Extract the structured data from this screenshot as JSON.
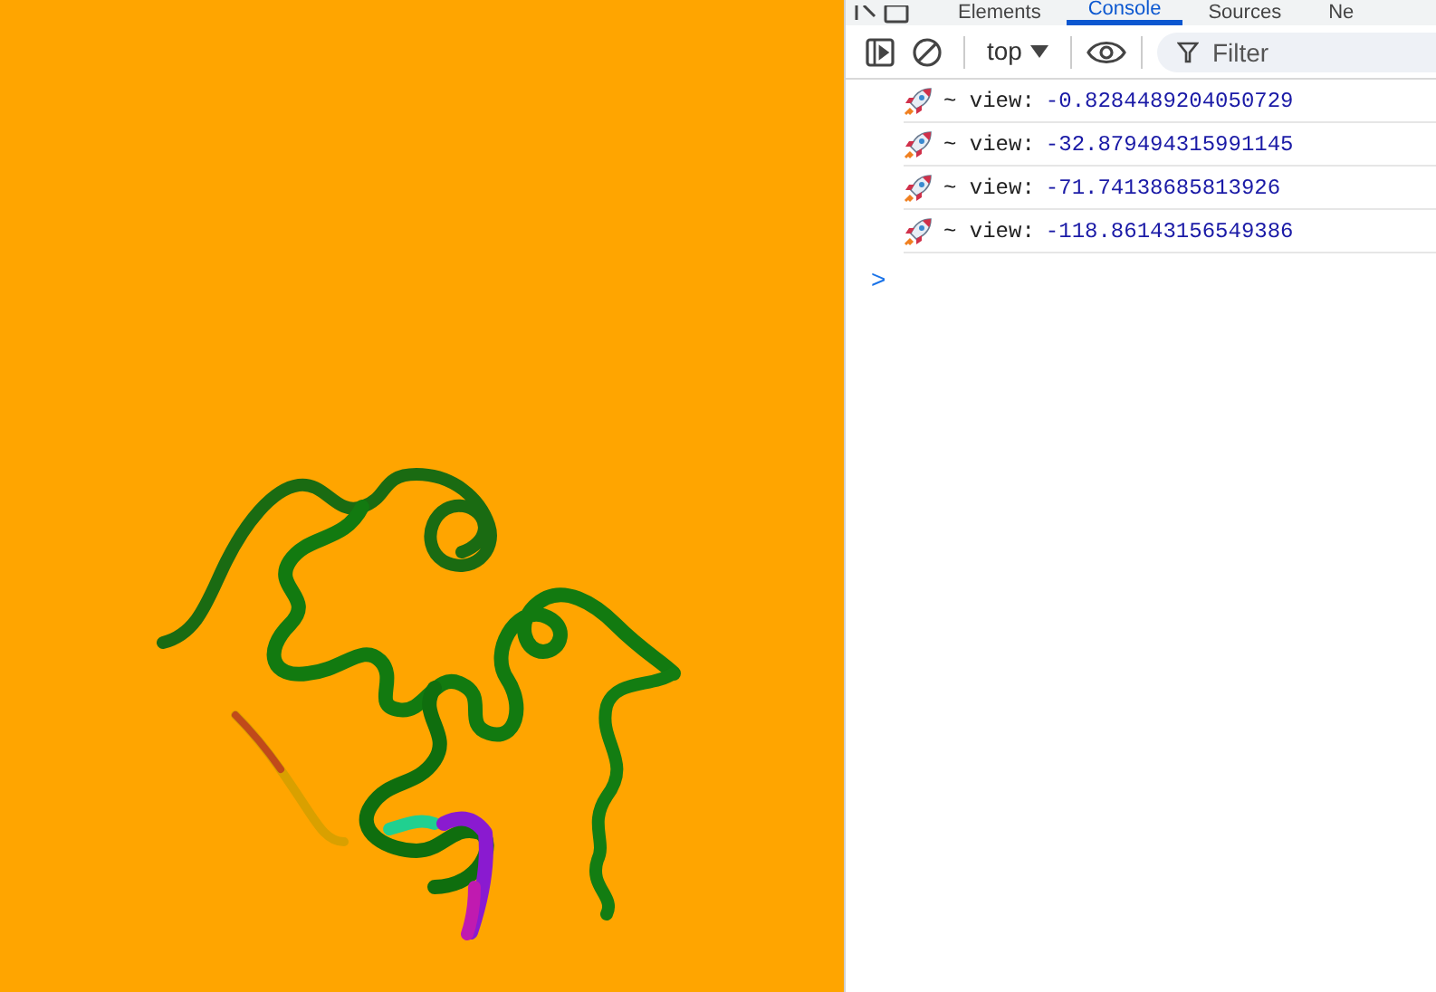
{
  "devtools": {
    "tabs": [
      {
        "label": "Elements",
        "selected": false
      },
      {
        "label": "Console",
        "selected": true
      },
      {
        "label": "Sources",
        "selected": false
      },
      {
        "label": "Ne",
        "selected": false
      }
    ],
    "toolbar": {
      "context": "top",
      "filter": {
        "placeholder": "Filter"
      }
    },
    "messages": [
      {
        "label": "~ view:",
        "value": "-0.8284489204050729"
      },
      {
        "label": "~ view:",
        "value": "-32.879494315991145"
      },
      {
        "label": "~ view:",
        "value": "-71.74138685813926"
      },
      {
        "label": "~ view:",
        "value": "-118.86143156549386"
      }
    ],
    "prompt": ">"
  }
}
